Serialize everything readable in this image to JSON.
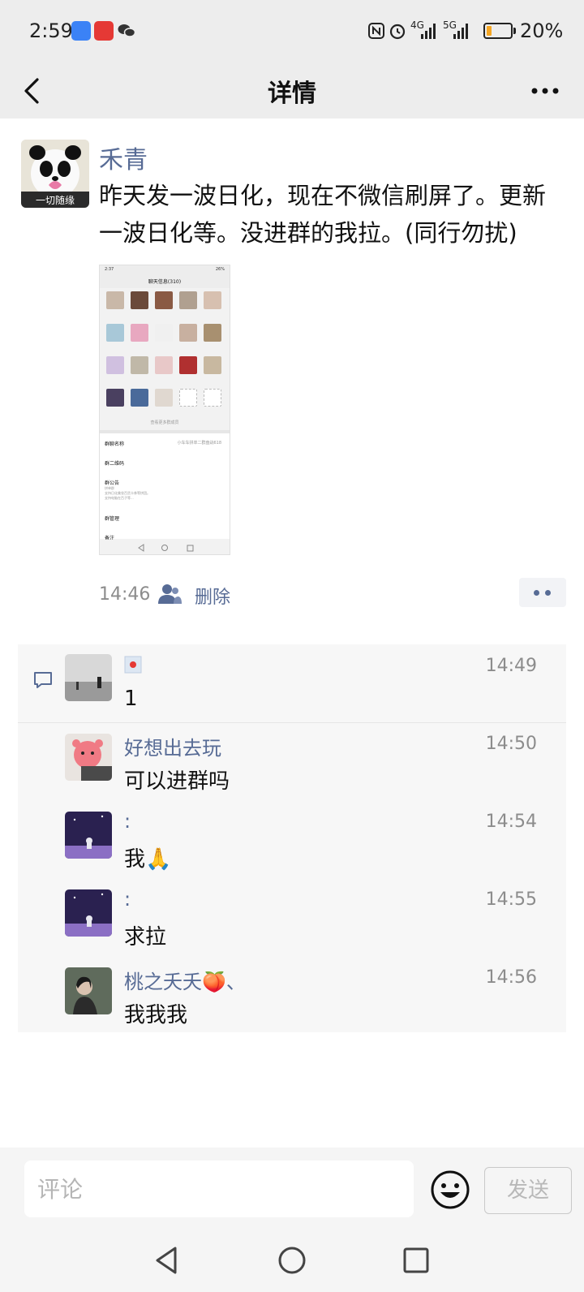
{
  "status_bar": {
    "time": "2:59",
    "network_4g": "4G",
    "network_5g": "5G",
    "battery": "20%",
    "battery_level": 0.2
  },
  "nav": {
    "title": "详情",
    "back_icon": "chevron-left-icon",
    "more_icon": "more-horizontal-icon"
  },
  "post": {
    "author": "禾青",
    "avatar_caption": "一切随缘",
    "text": "昨天发一波日化，现在不微信刷屏了。更新一波日化等。没进群的我拉。(同行勿扰)",
    "image": {
      "header_time": "2:37",
      "header_battery": "26%",
      "title": "聊天信息(310)",
      "view_more": "查看更多群成员",
      "rows": [
        {
          "label": "群聊名称",
          "value": "小车车拼单二群盘战618"
        },
        {
          "label": "群二维码",
          "value": ""
        },
        {
          "label": "群公告",
          "value": "拼单群\n支持日化美妆百货卡券等拼团。\n支持电脑在百子等..."
        },
        {
          "label": "群管理",
          "value": ""
        },
        {
          "label": "备注",
          "value": ""
        }
      ]
    },
    "time": "14:46",
    "delete_label": "删除"
  },
  "comments": [
    {
      "name": "",
      "text": "1",
      "time": "14:49"
    },
    {
      "name": "好想出去玩",
      "text": "可以进群吗",
      "time": "14:50"
    },
    {
      "name": ":",
      "text": "我🙏",
      "time": "14:54"
    },
    {
      "name": ":",
      "text": "求拉",
      "time": "14:55"
    },
    {
      "name": "桃之夭夭🍑、",
      "text": "我我我",
      "time": "14:56"
    }
  ],
  "comment_bar": {
    "placeholder": "评论",
    "send_label": "发送"
  },
  "colors": {
    "link": "#576b95",
    "background_gray": "#ededed",
    "comment_bg": "#f7f7f7",
    "battery": "#f5a623"
  }
}
